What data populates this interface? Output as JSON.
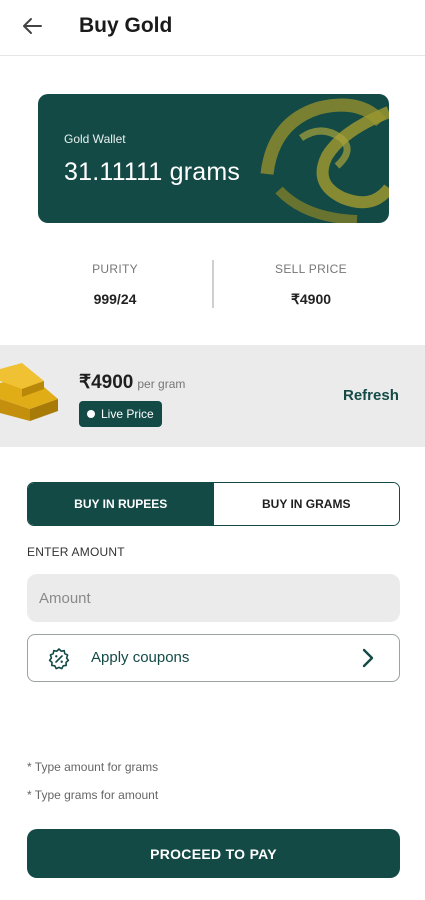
{
  "header": {
    "title": "Buy Gold",
    "back_icon": "arrow-left-icon"
  },
  "wallet": {
    "label": "Gold Wallet",
    "grams": "31.11111 grams",
    "logo": "brand-logo"
  },
  "stats": {
    "purity": {
      "label": "PURITY",
      "value": "999/24"
    },
    "sell_price": {
      "label": "SELL PRICE",
      "value": "₹4900"
    }
  },
  "price": {
    "value": "₹4900",
    "unit": "per gram",
    "live_label": "Live Price",
    "refresh_label": "Refresh",
    "image": "gold-bars-icon"
  },
  "mode_toggle": {
    "options": [
      {
        "label": "BUY IN RUPEES",
        "active": true
      },
      {
        "label": "BUY IN GRAMS",
        "active": false
      }
    ]
  },
  "amount": {
    "label": "ENTER AMOUNT",
    "placeholder": "Amount",
    "value": ""
  },
  "coupon": {
    "label": "Apply coupons",
    "icon": "discount-badge-icon"
  },
  "hints": [
    "* Type amount for grams",
    "* Type grams for amount"
  ],
  "proceed": {
    "label": "PROCEED TO PAY"
  },
  "colors": {
    "brand": "#134a46",
    "gold": "#b59a2e",
    "band": "#ebebeb"
  }
}
